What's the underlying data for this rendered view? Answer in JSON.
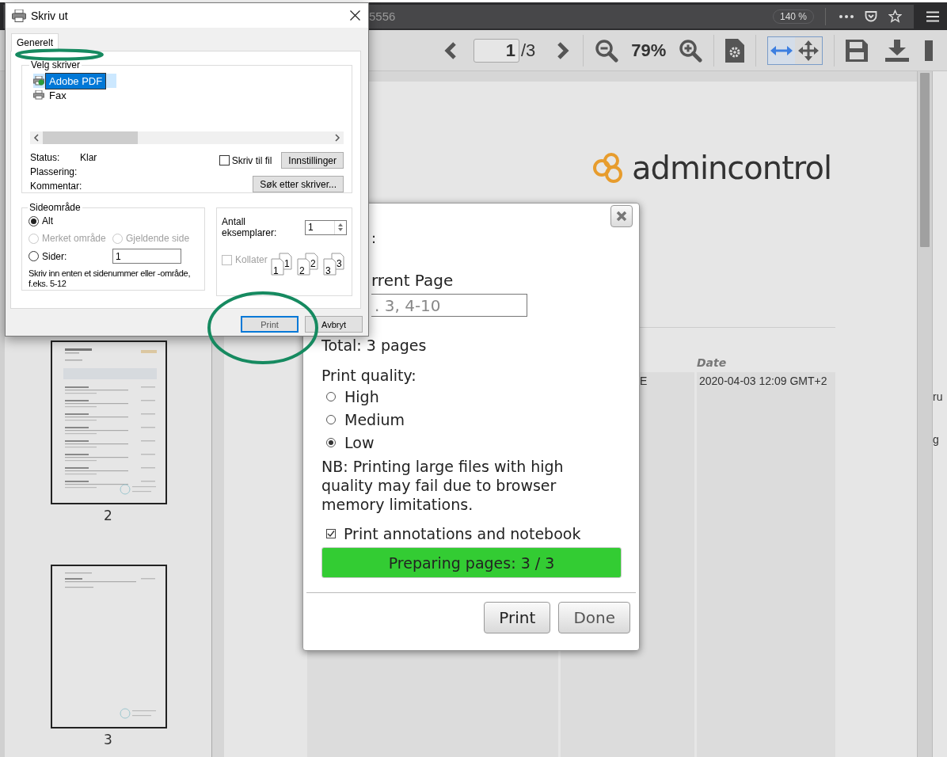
{
  "browser": {
    "url_fragment": "5556",
    "zoom_badge": "140 %"
  },
  "pdf_toolbar": {
    "page_input": "1",
    "page_total": "/3",
    "zoom": "79%",
    "fit_modes": [
      {
        "kind": "fit-width",
        "selected": true
      },
      {
        "kind": "move",
        "selected": false
      }
    ]
  },
  "sidebar": {
    "thumbnails": [
      {
        "label": "2",
        "kind": "full"
      },
      {
        "label": "3",
        "kind": "short"
      }
    ]
  },
  "document": {
    "logo_text": "admincontrol",
    "table": {
      "header": "Date",
      "cells": [
        "E",
        "2020-04-03 12:09 GMT+2"
      ]
    },
    "edge_fragments": [
      "ru",
      "g"
    ]
  },
  "print_popup": {
    "title_fragment": ":",
    "range_label": "rrent Page",
    "range_placeholder": ". 3, 4-10",
    "total": "Total: 3 pages",
    "quality_label": "Print quality:",
    "quality_options": [
      {
        "label": "High",
        "selected": false
      },
      {
        "label": "Medium",
        "selected": false
      },
      {
        "label": "Low",
        "selected": true
      }
    ],
    "note": "NB: Printing large files with high quality may fail due to browser memory limitations.",
    "annotations": {
      "label": "Print annotations and notebook",
      "checked": true
    },
    "progress": {
      "label": "Preparing pages: 3 / 3",
      "level": 1
    },
    "buttons": [
      {
        "label": "Print",
        "kind": "primary"
      },
      {
        "label": "Done",
        "kind": "secondary"
      }
    ]
  },
  "print_dialog": {
    "title": "Skriv ut",
    "tabs": [
      {
        "label": "Generelt",
        "selected": true
      }
    ],
    "printer_group": "Velg skriver",
    "printers": [
      {
        "label": "Adobe PDF",
        "selected": true
      },
      {
        "label": "Fax",
        "selected": false
      }
    ],
    "status_rows": [
      {
        "label": "Status:",
        "value": "Klar"
      },
      {
        "label": "Plassering:"
      },
      {
        "label": "Kommentar:"
      }
    ],
    "print_to_file": {
      "label": "Skriv til fil",
      "checked": false
    },
    "settings_button": "Innstillinger",
    "find_printer_button": "Søk etter skriver...",
    "range_group": "Sideområde",
    "range_options": [
      {
        "label": "Alt",
        "selected": true,
        "disabled": false
      },
      {
        "label": "Merket område",
        "selected": false,
        "disabled": true
      },
      {
        "label": "Gjeldende side",
        "selected": false,
        "disabled": true
      },
      {
        "label": "Sider:",
        "selected": false,
        "disabled": false
      }
    ],
    "pages_value": "1",
    "range_hint": "Skriv inn enten et sidenummer eller -område, f.eks. 5-12",
    "copies_label": "Antall eksemplarer:",
    "copies_value": "1",
    "collate": {
      "label": "Kollater",
      "checked": false,
      "disabled": true
    },
    "collate_digits": [
      "1",
      "1",
      "2",
      "2",
      "3",
      "3"
    ],
    "buttons": [
      {
        "label": "Print",
        "focused": true
      },
      {
        "label": "Avbryt",
        "focused": false
      }
    ]
  }
}
